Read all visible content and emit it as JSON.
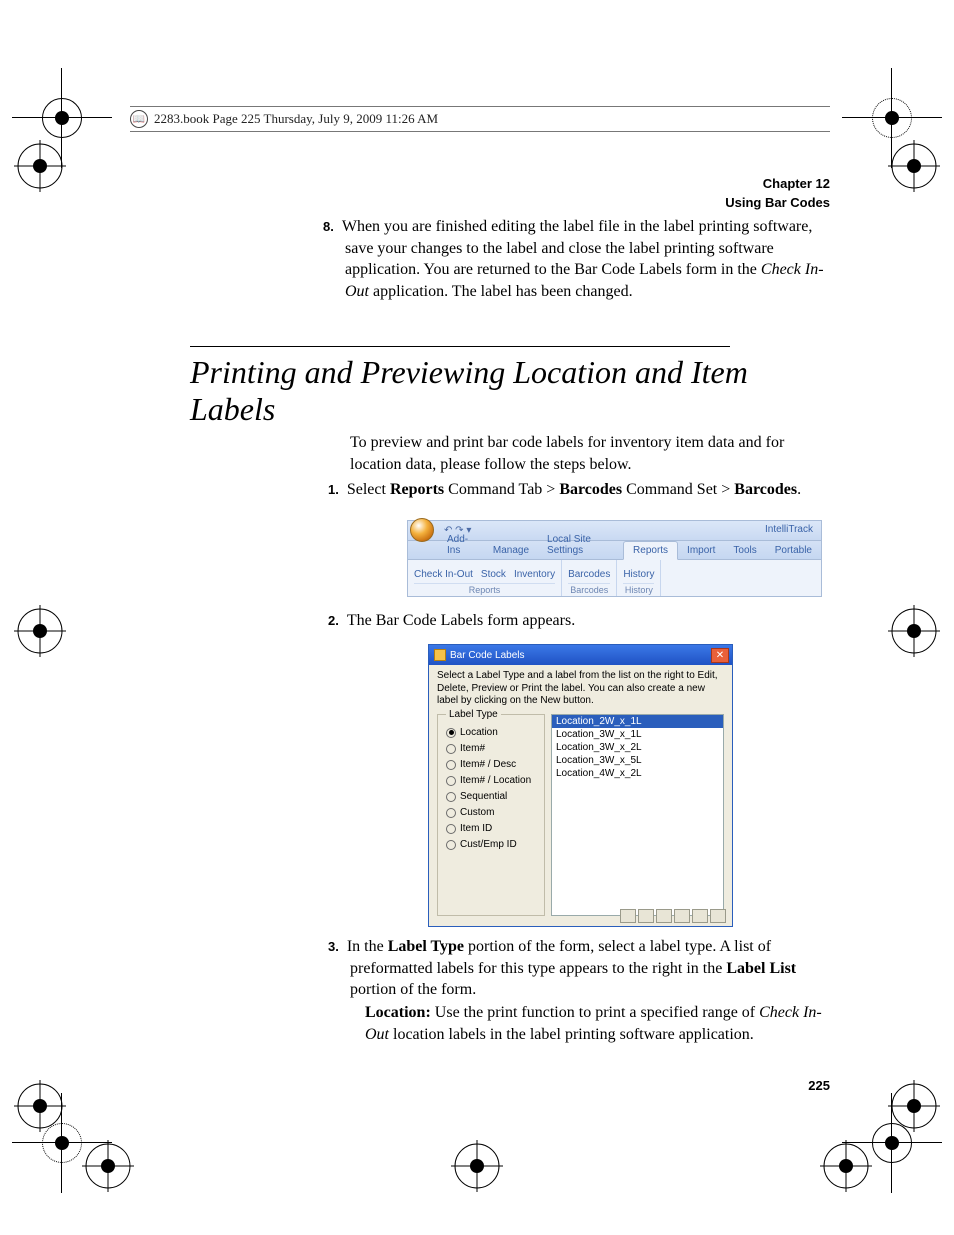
{
  "header": {
    "text": "2283.book  Page 225  Thursday, July 9, 2009  11:26 AM"
  },
  "chapter": {
    "label": "Chapter 12",
    "title": "Using Bar Codes"
  },
  "step8": {
    "num": "8.",
    "text_before_italic": "When you are finished editing the label file in the label printing software, save your changes to the label and close the label printing software application. You are returned to the Bar Code Labels form in the ",
    "italic": "Check In-Out",
    "text_after_italic": " application. The label has been changed."
  },
  "section_title": "Printing and Previewing Location and Item Labels",
  "intro": "To preview and print bar code labels for inventory item data and for location data, please follow the steps below.",
  "step1": {
    "num": "1.",
    "a": "Select ",
    "b": "Reports",
    "c": " Command Tab > ",
    "d": "Barcodes",
    "e": " Command Set > ",
    "f": "Barcodes",
    "g": "."
  },
  "ribbon": {
    "brand": "IntelliTrack",
    "tabs": [
      "Add-Ins",
      "Manage",
      "Local Site Settings",
      "Reports",
      "Import",
      "Tools",
      "Portable"
    ],
    "active_tab_index": 3,
    "group_reports": {
      "name": "Reports",
      "buttons": [
        "Check In-Out",
        "Stock",
        "Inventory"
      ]
    },
    "group_barcodes": {
      "name": "Barcodes",
      "buttons": [
        "Barcodes"
      ]
    },
    "group_history": {
      "name": "History",
      "buttons": [
        "History"
      ]
    }
  },
  "step2": {
    "num": "2.",
    "text": "The Bar Code Labels form appears."
  },
  "dialog": {
    "title": "Bar Code Labels",
    "instruction": "Select a Label Type and a label from the list on the right to Edit, Delete, Preview or Print the label. You can also create a new label by clicking on the New button.",
    "label_type_legend": "Label Type",
    "radios": [
      "Location",
      "Item#",
      "Item# / Desc",
      "Item# / Location",
      "Sequential",
      "Custom",
      "Item ID",
      "Cust/Emp ID"
    ],
    "selected_radio_index": 0,
    "list_items": [
      "Location_2W_x_1L",
      "Location_3W_x_1L",
      "Location_3W_x_2L",
      "Location_3W_x_5L",
      "Location_4W_x_2L"
    ],
    "selected_list_index": 0
  },
  "step3": {
    "num": "3.",
    "a": "In the ",
    "b": "Label Type",
    "c": " portion of the form, select a label type. A list of preformatted labels for this type appears to the right in the ",
    "d": "Label List",
    "e": " portion of the form."
  },
  "location_para": {
    "a": "Location:",
    "b": " Use the print function to print a specified range of ",
    "c": "Check In-Out",
    "d": " location labels in the label printing software application."
  },
  "page_number": "225"
}
